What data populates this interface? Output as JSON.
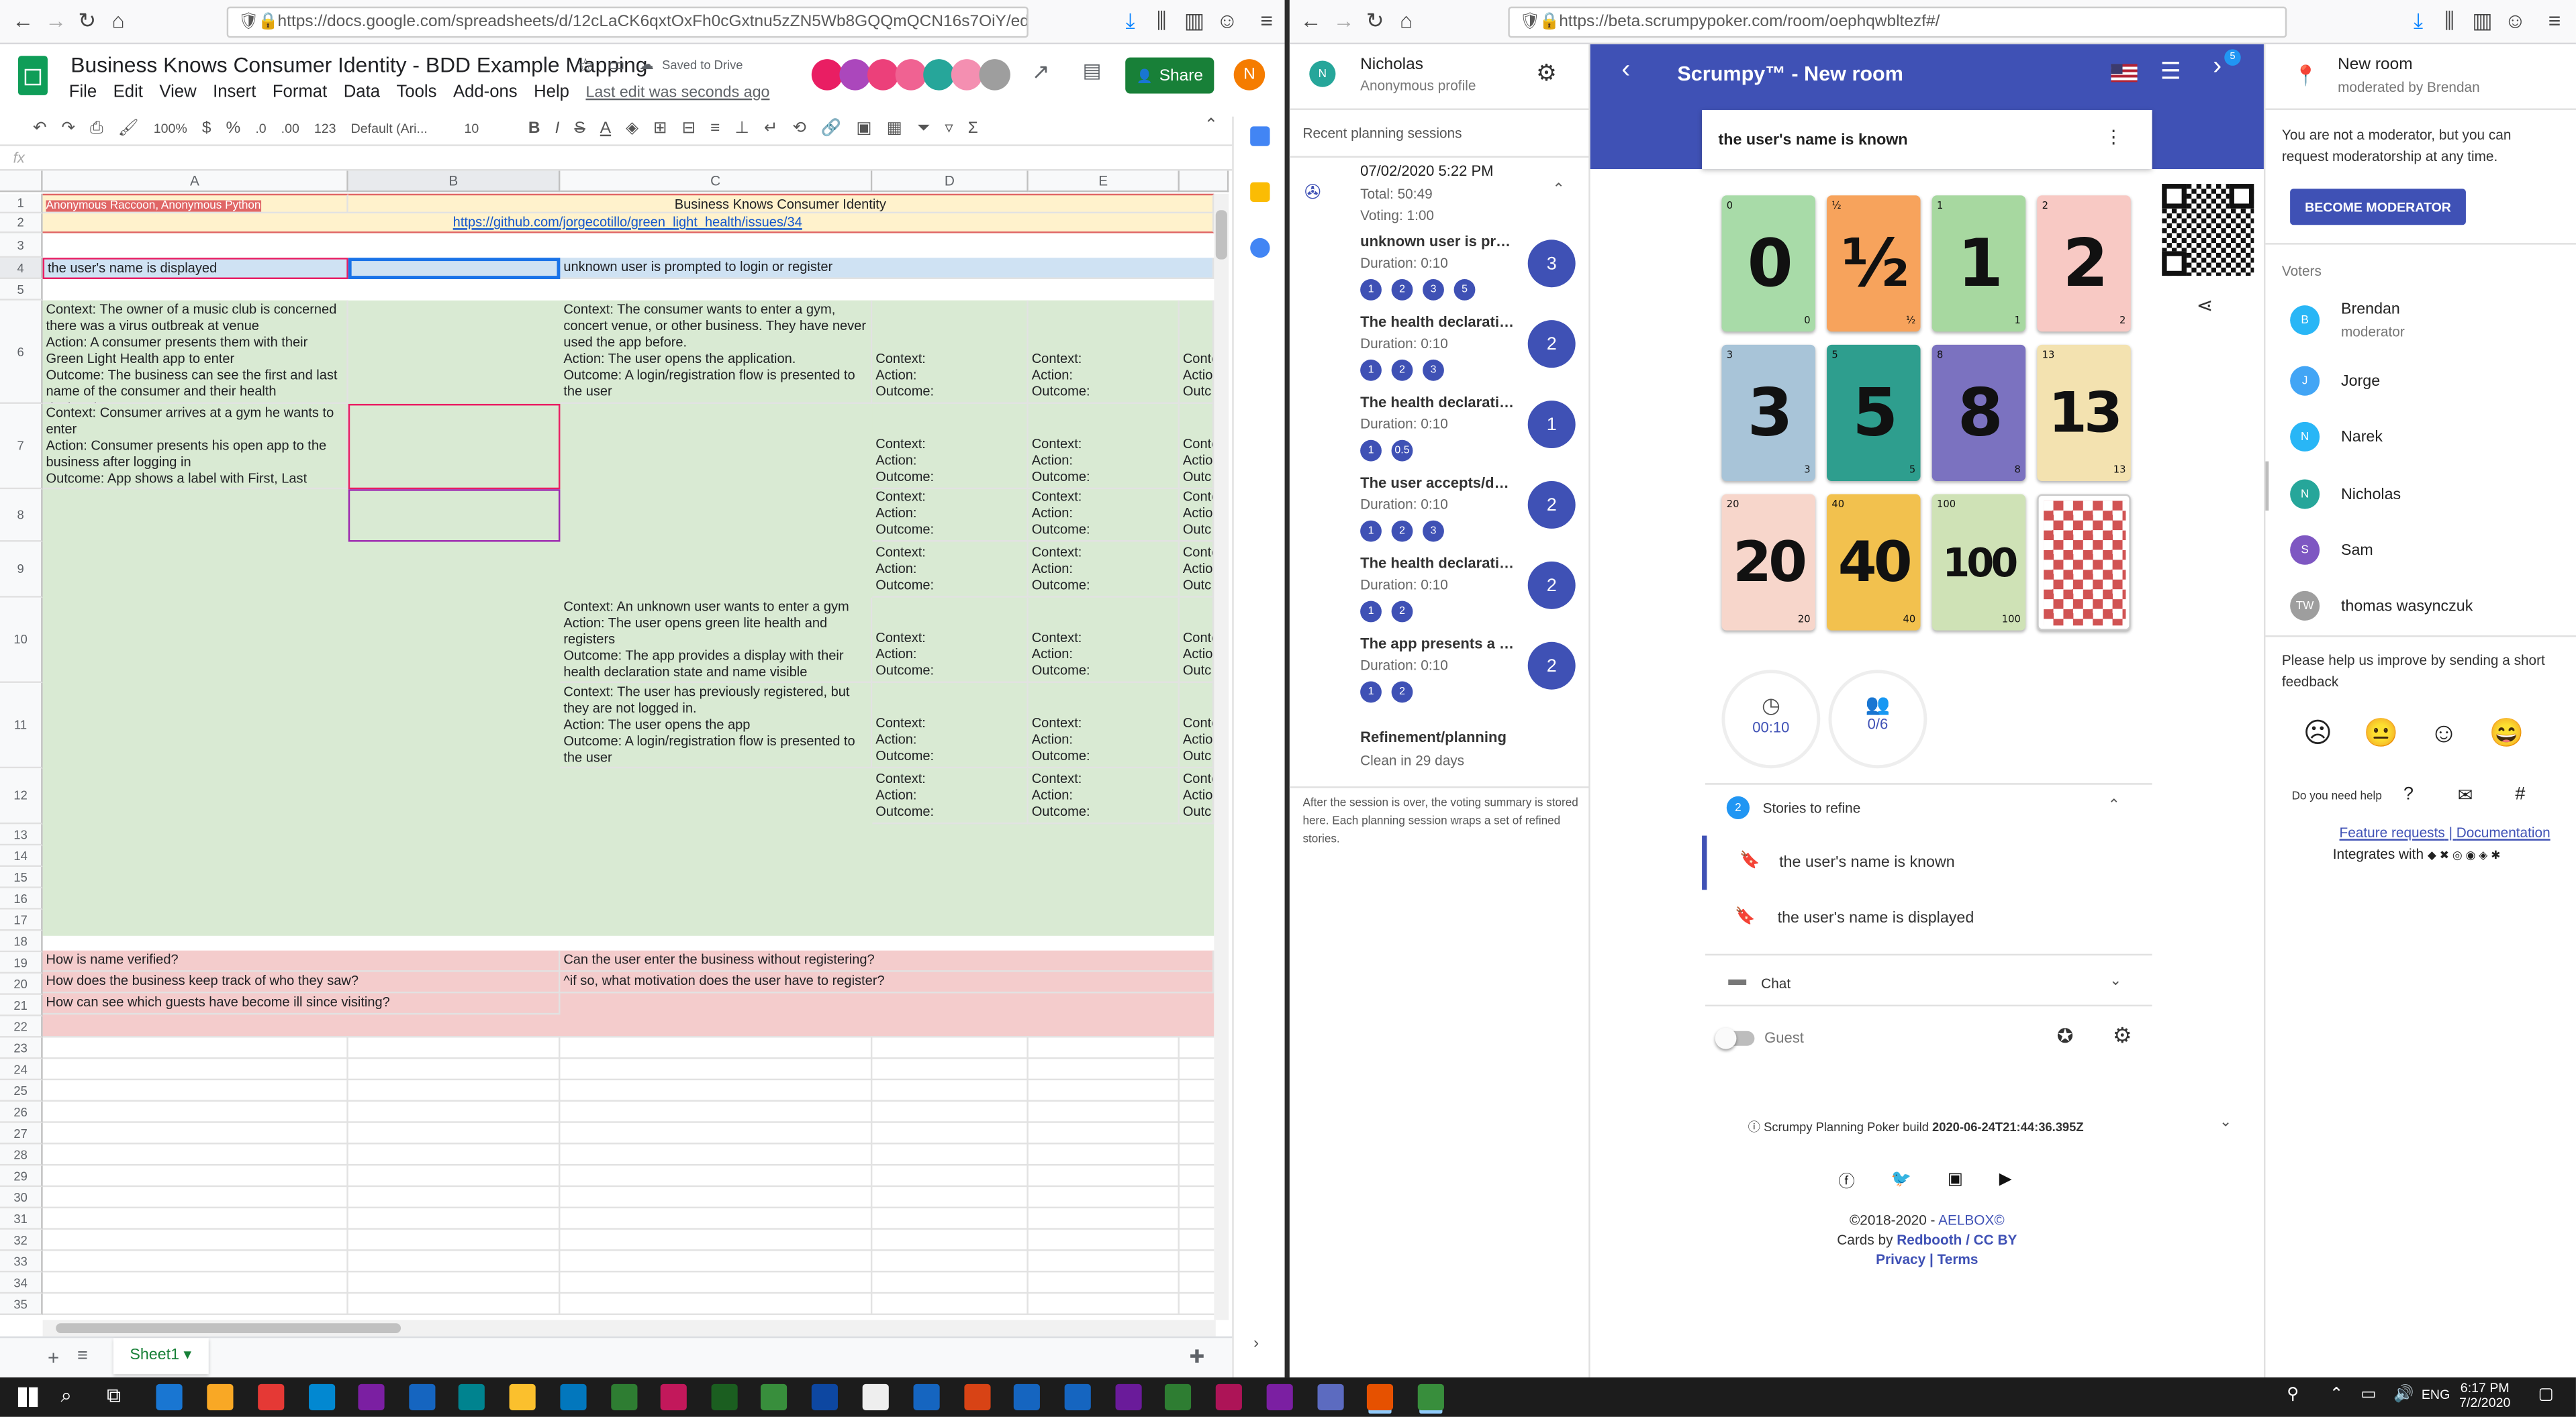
{
  "left_browser": {
    "url": "https://docs.google.com/spreadsheets/d/12cLaCK6qxtOxFh0cGxtnu5zZN5Wb8GQQmQCN16s7OiY/edit#"
  },
  "sheets": {
    "doc_title": "Business Knows Consumer Identity - BDD Example Mapping",
    "saved_status": "Saved to Drive",
    "menu": [
      "File",
      "Edit",
      "View",
      "Insert",
      "Format",
      "Data",
      "Tools",
      "Add-ons",
      "Help"
    ],
    "last_edit": "Last edit was seconds ago",
    "share_label": "Share",
    "user_initial": "N",
    "zoom": "100%",
    "font": "Default (Ari...",
    "font_size": "10",
    "fx": "fx",
    "col_headers": [
      "A",
      "B",
      "C",
      "D",
      "E"
    ],
    "row1_a": "Anonymous Raccoon, Anonymous Python",
    "row1_c": "Business Knows Consumer Identity",
    "row2_c": "https://github.com/jorgecotillo/green_light_health/issues/34",
    "row4_a": "the user's name is displayed",
    "row4_c": "unknown user is prompted to login or register",
    "row6_a": "Context: The owner of a music club is concerned there was a virus outbreak at venue\nAction: A consumer presents them with their Green Light Health app to enter\nOutcome: The business can see the first and last name of the consumer and their health declaration.",
    "row6_c": "Context: The consumer wants to enter a gym, concert venue, or other business. They have never used the app before.\nAction: The user opens the application.\nOutcome: A login/registration flow is presented to the user",
    "row7_a": "Context: Consumer arrives at a gym he wants to enter\nAction: Consumer presents his open app to the business after logging in\nOutcome: App shows a label with First, Last Name",
    "row10_c": "Context: An unknown user wants to enter a gym\nAction: The user opens green lite health and registers\nOutcome: The app provides a display with their health declaration state and name visible",
    "row11_c": "Context: The user has previously registered, but they are not logged in.\nAction: The user opens the app\nOutcome: A login/registration flow is presented to the user",
    "cao": "Context:\nAction:\nOutcome:",
    "cao_cut": "Conte\nActio\nOutc",
    "row19_a": "How is name verified?",
    "row19_c": "Can the user enter the business without registering?",
    "row20_a": "How does the business keep track of who they saw?",
    "row20_c": "^if so, what motivation does the user have to register?",
    "row21_a": "How can see which guests have become ill since visiting?",
    "sheet_tab": "Sheet1"
  },
  "right_browser": {
    "url": "https://beta.scrumpypoker.com/room/oephqwbltezf#/"
  },
  "scrumpy": {
    "profile_name": "Nicholas",
    "profile_sub": "Anonymous profile",
    "recent_label": "Recent planning sessions",
    "session_date": "07/02/2020 5:22 PM",
    "session_total": "Total: 50:49",
    "session_voting": "Voting: 1:00",
    "sessions": [
      {
        "title": "unknown user is prom...",
        "duration": "Duration: 0:10",
        "chips": [
          "1",
          "2",
          "3",
          "5"
        ],
        "result": "3"
      },
      {
        "title": "The health declaration ...",
        "duration": "Duration: 0:10",
        "chips": [
          "1",
          "2",
          "3"
        ],
        "result": "2"
      },
      {
        "title": "The health declaration ...",
        "duration": "Duration: 0:10",
        "chips": [
          "1",
          "0.5"
        ],
        "result": "1"
      },
      {
        "title": "The user accepts/decli...",
        "duration": "Duration: 0:10",
        "chips": [
          "1",
          "2",
          "3"
        ],
        "result": "2"
      },
      {
        "title": "The health declaration ...",
        "duration": "Duration: 0:10",
        "chips": [
          "1",
          "2"
        ],
        "result": "2"
      },
      {
        "title": "The app presents a he...",
        "duration": "Duration: 0:10",
        "chips": [
          "1",
          "2"
        ],
        "result": "2"
      }
    ],
    "refinement_title": "Refinement/planning",
    "refinement_sub": "Clean in 29 days",
    "session_note": "After the session is over, the voting summary is stored here. Each planning session wraps a set of refined stories.",
    "header_title": "Scrumpy™ - New room",
    "badge": "5",
    "current_story": "the user's name is known",
    "cards": [
      {
        "value": "0",
        "color": "#a8dba8"
      },
      {
        "value": "½",
        "color": "#f7a35c"
      },
      {
        "value": "1",
        "color": "#a7d8a0"
      },
      {
        "value": "2",
        "color": "#f8c9c4"
      },
      {
        "value": "3",
        "color": "#a8c4d8"
      },
      {
        "value": "5",
        "color": "#2e9e8e"
      },
      {
        "value": "8",
        "color": "#7b72c0"
      },
      {
        "value": "13",
        "color": "#f3e2b0"
      },
      {
        "value": "20",
        "color": "#f7d6cb"
      },
      {
        "value": "40",
        "color": "#f2c14e"
      },
      {
        "value": "100",
        "color": "#cfe2b6"
      }
    ],
    "timer": "00:10",
    "votes": "0/6",
    "stories_count": "2",
    "stories_label": "Stories to refine",
    "stories": [
      "the user's name is known",
      "the user's name is displayed"
    ],
    "chat_label": "Chat",
    "guest_label": "Guest",
    "build_text": "Scrumpy Planning Poker build ",
    "build_id": "2020-06-24T21:44:36.395Z",
    "copyright_prefix": "©2018-2020 - ",
    "copyright_brand": "AELBOX©",
    "cards_by": "Cards by ",
    "cards_link": "Redbooth / CC BY",
    "privacy": "Privacy",
    "terms": "Terms",
    "room_title": "New room",
    "moderated_by": "moderated by Brendan",
    "moderator_note": "You are not a moderator, but you can request moderatorship at any time.",
    "become_moderator": "BECOME MODERATOR",
    "voters_label": "Voters",
    "voters": [
      {
        "initial": "B",
        "name": "Brendan",
        "sub": "moderator",
        "color": "#29b6f6"
      },
      {
        "initial": "J",
        "name": "Jorge",
        "sub": "",
        "color": "#42a5f5"
      },
      {
        "initial": "N",
        "name": "Narek",
        "sub": "",
        "color": "#29b6f6"
      },
      {
        "initial": "N",
        "name": "Nicholas",
        "sub": "",
        "color": "#26a69a"
      },
      {
        "initial": "S",
        "name": "Sam",
        "sub": "",
        "color": "#7e57c2"
      },
      {
        "initial": "TW",
        "name": "thomas wasynczuk",
        "sub": "",
        "color": "#9e9e9e"
      }
    ],
    "feedback_text": "Please help us improve by sending a short feedback",
    "help_text": "Do you need help",
    "feature_requests": "Feature requests",
    "documentation": "Documentation",
    "integrates": "Integrates with"
  },
  "taskbar": {
    "lang": "ENG",
    "time": "6:17 PM",
    "date": "7/2/2020"
  }
}
